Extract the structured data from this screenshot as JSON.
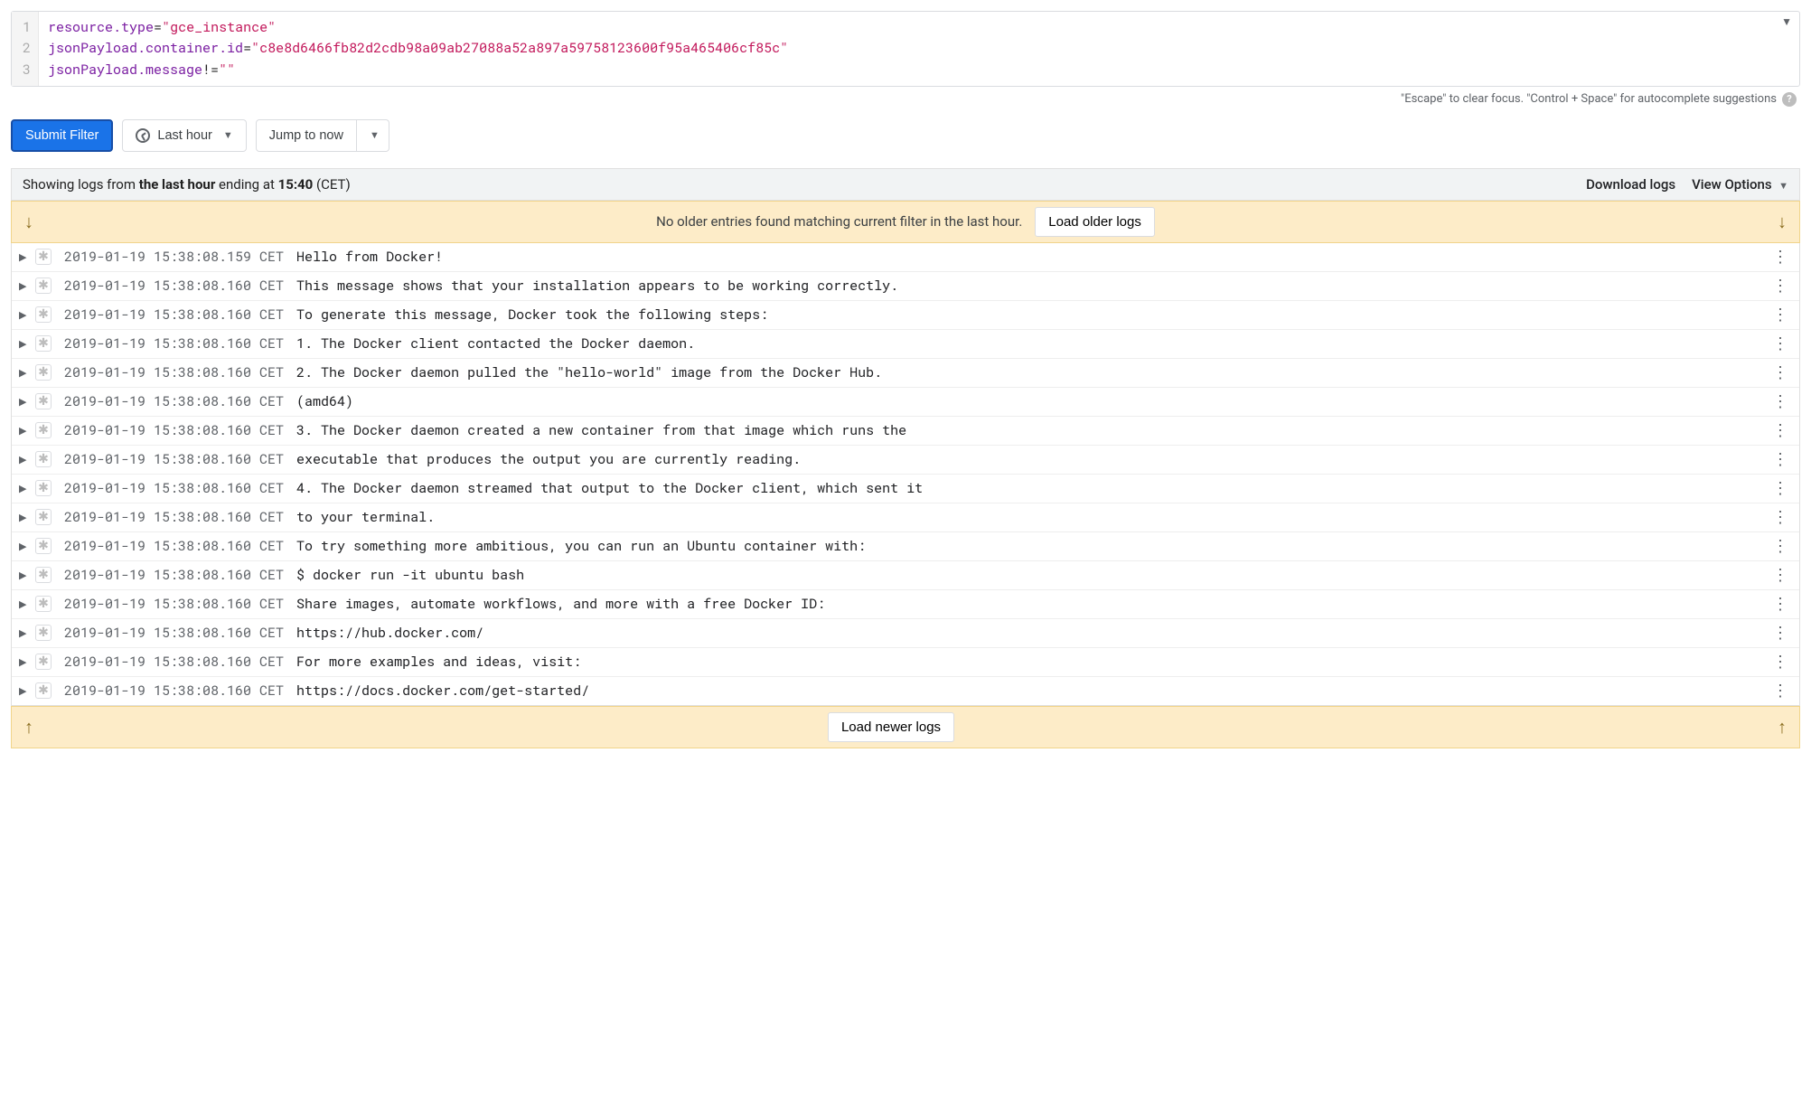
{
  "filter": {
    "lines": [
      {
        "num": "1",
        "key": "resource.type",
        "op": "=",
        "val": "\"gce_instance\""
      },
      {
        "num": "2",
        "key": "jsonPayload.container.id",
        "op": "=",
        "val": "\"c8e8d6466fb82d2cdb98a09ab27088a52a897a59758123600f95a465406cf85c\""
      },
      {
        "num": "3",
        "key": "jsonPayload.message",
        "op": "!=",
        "val": "\"\""
      }
    ],
    "dropdown_caret": "▼"
  },
  "hint": {
    "text": "\"Escape\" to clear focus. \"Control + Space\" for autocomplete suggestions"
  },
  "toolbar": {
    "submit_label": "Submit Filter",
    "time_label": "Last hour",
    "jump_label": "Jump to now"
  },
  "status": {
    "prefix": "Showing logs from ",
    "range": "the last hour",
    "middle": " ending at ",
    "time": "15:40",
    "tz": " (CET)",
    "download_label": "Download logs",
    "view_options_label": "View Options"
  },
  "older_banner": {
    "message": "No older entries found matching current filter in the last hour.",
    "button": "Load older logs"
  },
  "logs": [
    {
      "ts": "2019-01-19 15:38:08.159 CET",
      "msg": "Hello from Docker!"
    },
    {
      "ts": "2019-01-19 15:38:08.160 CET",
      "msg": "This message shows that your installation appears to be working correctly."
    },
    {
      "ts": "2019-01-19 15:38:08.160 CET",
      "msg": "To generate this message, Docker took the following steps:"
    },
    {
      "ts": "2019-01-19 15:38:08.160 CET",
      "msg": "1. The Docker client contacted the Docker daemon."
    },
    {
      "ts": "2019-01-19 15:38:08.160 CET",
      "msg": "2. The Docker daemon pulled the \"hello-world\" image from the Docker Hub."
    },
    {
      "ts": "2019-01-19 15:38:08.160 CET",
      "msg": "(amd64)"
    },
    {
      "ts": "2019-01-19 15:38:08.160 CET",
      "msg": "3. The Docker daemon created a new container from that image which runs the"
    },
    {
      "ts": "2019-01-19 15:38:08.160 CET",
      "msg": "executable that produces the output you are currently reading."
    },
    {
      "ts": "2019-01-19 15:38:08.160 CET",
      "msg": "4. The Docker daemon streamed that output to the Docker client, which sent it"
    },
    {
      "ts": "2019-01-19 15:38:08.160 CET",
      "msg": "to your terminal."
    },
    {
      "ts": "2019-01-19 15:38:08.160 CET",
      "msg": "To try something more ambitious, you can run an Ubuntu container with:"
    },
    {
      "ts": "2019-01-19 15:38:08.160 CET",
      "msg": "$ docker run -it ubuntu bash"
    },
    {
      "ts": "2019-01-19 15:38:08.160 CET",
      "msg": "Share images, automate workflows, and more with a free Docker ID:"
    },
    {
      "ts": "2019-01-19 15:38:08.160 CET",
      "msg": "https://hub.docker.com/"
    },
    {
      "ts": "2019-01-19 15:38:08.160 CET",
      "msg": "For more examples and ideas, visit:"
    },
    {
      "ts": "2019-01-19 15:38:08.160 CET",
      "msg": "https://docs.docker.com/get-started/"
    }
  ],
  "newer_banner": {
    "button": "Load newer logs"
  },
  "glyphs": {
    "down_arrow": "↓",
    "up_arrow": "↑",
    "caret": "▼",
    "expand": "▶",
    "kebab": "⋮",
    "severity": "✱",
    "help": "?"
  }
}
